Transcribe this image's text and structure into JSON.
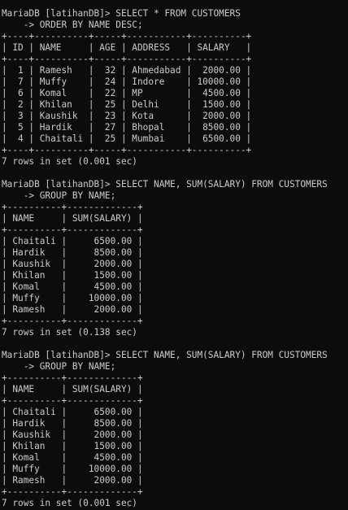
{
  "terminal": {
    "lines": [
      "MariaDB [latihanDB]> SELECT * FROM CUSTOMERS",
      "    -> ORDER BY NAME DESC;",
      "+----+----------+-----+-----------+----------+",
      "| ID | NAME     | AGE | ADDRESS   | SALARY   |",
      "+----+----------+-----+-----------+----------+",
      "|  1 | Ramesh   |  32 | Ahmedabad |  2000.00 |",
      "|  7 | Muffy    |  24 | Indore    | 10000.00 |",
      "|  6 | Komal    |  22 | MP        |  4500.00 |",
      "|  2 | Khilan   |  25 | Delhi     |  1500.00 |",
      "|  3 | Kaushik  |  23 | Kota      |  2000.00 |",
      "|  5 | Hardik   |  27 | Bhopal    |  8500.00 |",
      "|  4 | Chaitali |  25 | Mumbai    |  6500.00 |",
      "+----+----------+-----+-----------+----------+",
      "7 rows in set (0.001 sec)",
      "",
      "MariaDB [latihanDB]> SELECT NAME, SUM(SALARY) FROM CUSTOMERS",
      "    -> GROUP BY NAME;",
      "+----------+-------------+",
      "| NAME     | SUM(SALARY) |",
      "+----------+-------------+",
      "| Chaitali |     6500.00 |",
      "| Hardik   |     8500.00 |",
      "| Kaushik  |     2000.00 |",
      "| Khilan   |     1500.00 |",
      "| Komal    |     4500.00 |",
      "| Muffy    |    10000.00 |",
      "| Ramesh   |     2000.00 |",
      "+----------+-------------+",
      "7 rows in set (0.138 sec)",
      "",
      "MariaDB [latihanDB]> SELECT NAME, SUM(SALARY) FROM CUSTOMERS",
      "    -> GROUP BY NAME;",
      "+----------+-------------+",
      "| NAME     | SUM(SALARY) |",
      "+----------+-------------+",
      "| Chaitali |     6500.00 |",
      "| Hardik   |     8500.00 |",
      "| Kaushik  |     2000.00 |",
      "| Khilan   |     1500.00 |",
      "| Komal    |     4500.00 |",
      "| Muffy    |    10000.00 |",
      "| Ramesh   |     2000.00 |",
      "+----------+-------------+",
      "7 rows in set (0.001 sec)"
    ]
  }
}
